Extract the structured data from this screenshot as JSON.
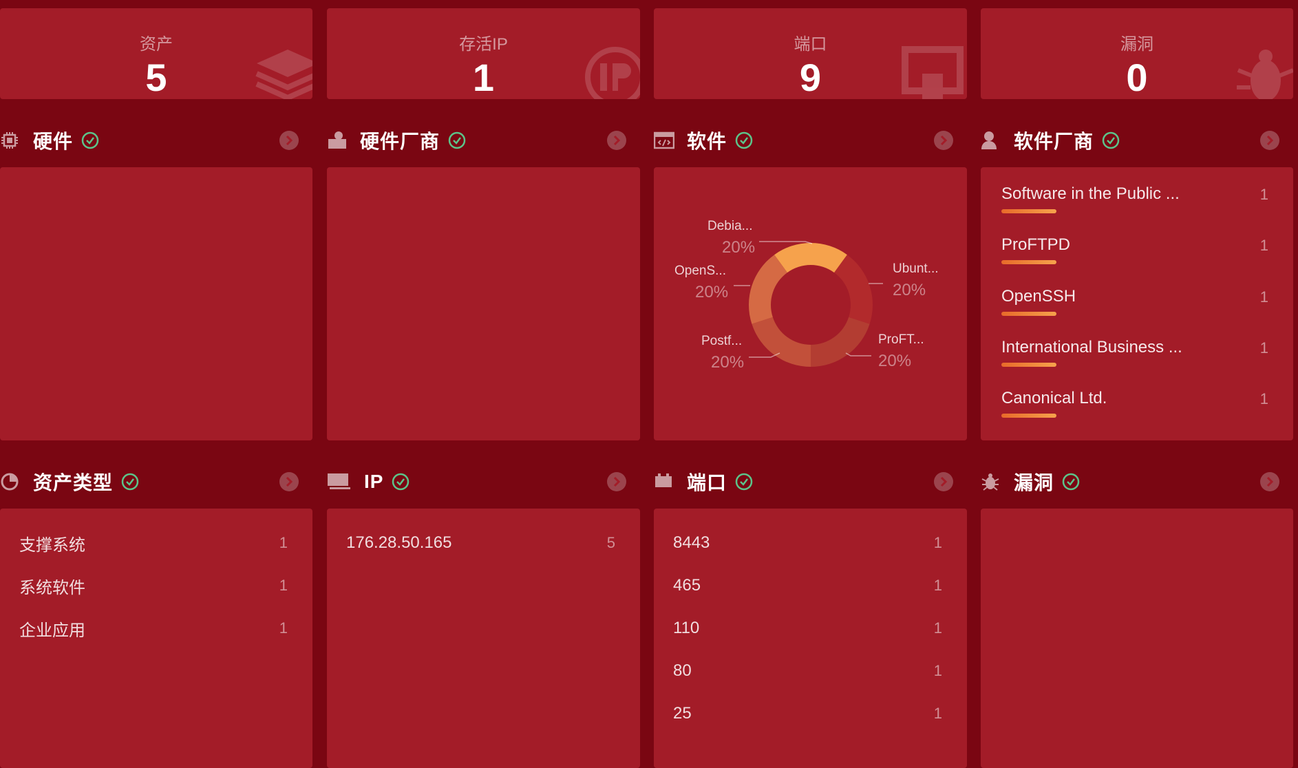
{
  "stats": [
    {
      "label": "资产",
      "value": "5",
      "icon": "layers-icon"
    },
    {
      "label": "存活IP",
      "value": "1",
      "icon": "ip-icon"
    },
    {
      "label": "端口",
      "value": "9",
      "icon": "port-icon"
    },
    {
      "label": "漏洞",
      "value": "0",
      "icon": "bug-icon"
    }
  ],
  "sections": {
    "hardware": {
      "title": "硬件",
      "icon": "chip-icon"
    },
    "hardware_vendor": {
      "title": "硬件厂商",
      "icon": "user-card-icon"
    },
    "software": {
      "title": "软件",
      "icon": "code-window-icon"
    },
    "software_vendor": {
      "title": "软件厂商",
      "icon": "person-icon"
    },
    "asset_type": {
      "title": "资产类型",
      "icon": "pie-chart-icon"
    },
    "ip": {
      "title": "IP",
      "icon": "monitor-icon"
    },
    "port": {
      "title": "端口",
      "icon": "port-icon"
    },
    "vuln": {
      "title": "漏洞",
      "icon": "bug-icon"
    }
  },
  "software_pie": {
    "slices": [
      {
        "name": "Debia...",
        "pct": "20%",
        "value": 20,
        "color": "#f6a24c"
      },
      {
        "name": "Ubunt...",
        "pct": "20%",
        "value": 20,
        "color": "#b22a2c"
      },
      {
        "name": "ProFT...",
        "pct": "20%",
        "value": 20,
        "color": "#b33d32"
      },
      {
        "name": "Postf...",
        "pct": "20%",
        "value": 20,
        "color": "#c2503a"
      },
      {
        "name": "OpenS...",
        "pct": "20%",
        "value": 20,
        "color": "#d56a44"
      }
    ]
  },
  "software_vendors": [
    {
      "name": "Software in the Public ...",
      "count": "1"
    },
    {
      "name": "ProFTPD",
      "count": "1"
    },
    {
      "name": "OpenSSH",
      "count": "1"
    },
    {
      "name": "International Business ...",
      "count": "1"
    },
    {
      "name": "Canonical Ltd.",
      "count": "1"
    }
  ],
  "asset_types": [
    {
      "name": "支撑系统",
      "count": "1"
    },
    {
      "name": "系统软件",
      "count": "1"
    },
    {
      "name": "企业应用",
      "count": "1"
    }
  ],
  "ips": [
    {
      "name": "176.28.50.165",
      "count": "5"
    }
  ],
  "ports": [
    {
      "name": "8443",
      "count": "1"
    },
    {
      "name": "465",
      "count": "1"
    },
    {
      "name": "110",
      "count": "1"
    },
    {
      "name": "80",
      "count": "1"
    },
    {
      "name": "25",
      "count": "1"
    }
  ],
  "colors": {
    "background": "#7a0612",
    "panel": "#a31c28",
    "accent": "#f6a24c",
    "check": "#5cc48a"
  }
}
